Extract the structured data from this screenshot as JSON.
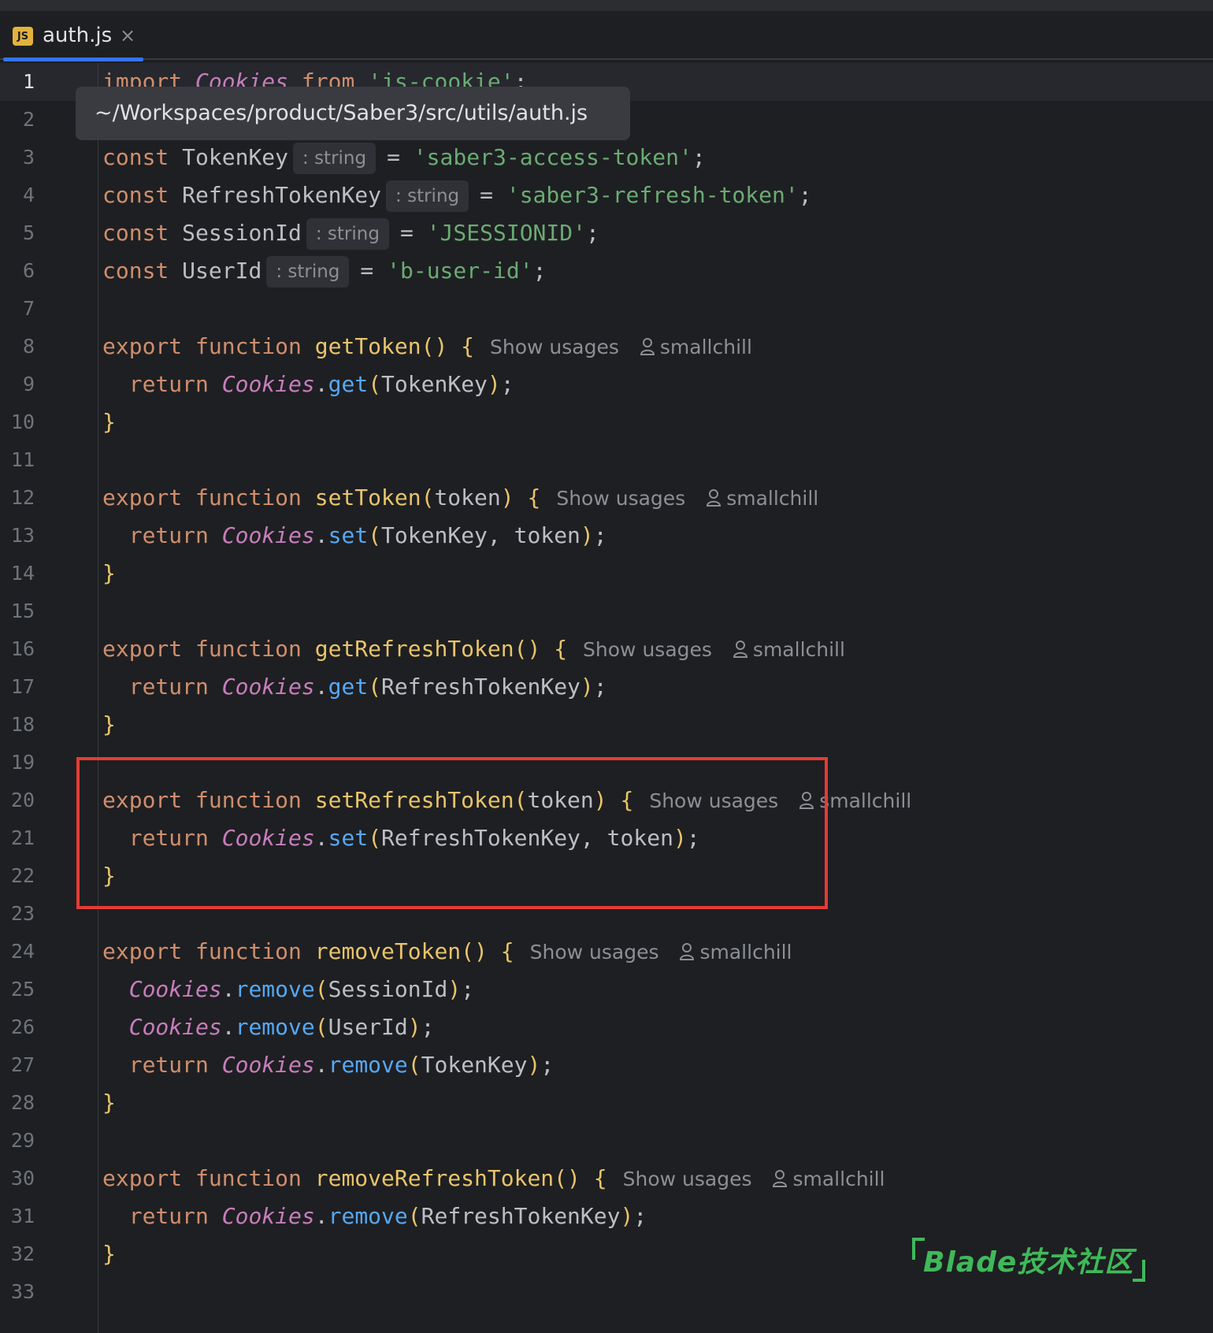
{
  "tab": {
    "badge": "JS",
    "file_name": "auth.js",
    "close_glyph": "×"
  },
  "tooltip": {
    "path": "~/Workspaces/product/Saber3/src/utils/auth.js"
  },
  "watermark": {
    "text": "Blade技术社区"
  },
  "colors": {
    "keyword": "#cf8e6d",
    "function": "#e8c46a",
    "class": "#c77dbb",
    "method": "#56a8f5",
    "string": "#6aab73",
    "highlight_border": "#e53b36",
    "watermark": "#3fb95a"
  },
  "code": {
    "lines": {
      "n1": "1",
      "n2": "2",
      "n3": "3",
      "n4": "4",
      "n5": "5",
      "n6": "6",
      "n7": "7",
      "n8": "8",
      "n9": "9",
      "n10": "10",
      "n11": "11",
      "n12": "12",
      "n13": "13",
      "n14": "14",
      "n15": "15",
      "n16": "16",
      "n17": "17",
      "n18": "18",
      "n19": "19",
      "n20": "20",
      "n21": "21",
      "n22": "22",
      "n23": "23",
      "n24": "24",
      "n25": "25",
      "n26": "26",
      "n27": "27",
      "n28": "28",
      "n29": "29",
      "n30": "30",
      "n31": "31",
      "n32": "32",
      "n33": "33"
    },
    "kw_import": "import",
    "kw_from": "from",
    "kw_const": "const",
    "kw_export": "export",
    "kw_function": "function",
    "kw_return": "return",
    "cls_cookies": "Cookies",
    "str_js_cookie": "'js-cookie'",
    "id_token_key": "TokenKey",
    "id_refresh_token_key": "RefreshTokenKey",
    "id_session_id": "SessionId",
    "id_user_id": "UserId",
    "hint_string": ": string",
    "str_access_token": "'saber3-access-token'",
    "str_refresh_token": "'saber3-refresh-token'",
    "str_jsessionid": "'JSESSIONID'",
    "str_user_id": "'b-user-id'",
    "fn_get_token": "getToken",
    "fn_set_token": "setToken",
    "fn_get_refresh_token": "getRefreshToken",
    "fn_set_refresh_token": "setRefreshToken",
    "fn_remove_token": "removeToken",
    "fn_remove_refresh_token": "removeRefreshToken",
    "param_token": "token",
    "m_get": "get",
    "m_set": "set",
    "m_remove": "remove",
    "show_usages": "Show usages",
    "author": "smallchill"
  }
}
